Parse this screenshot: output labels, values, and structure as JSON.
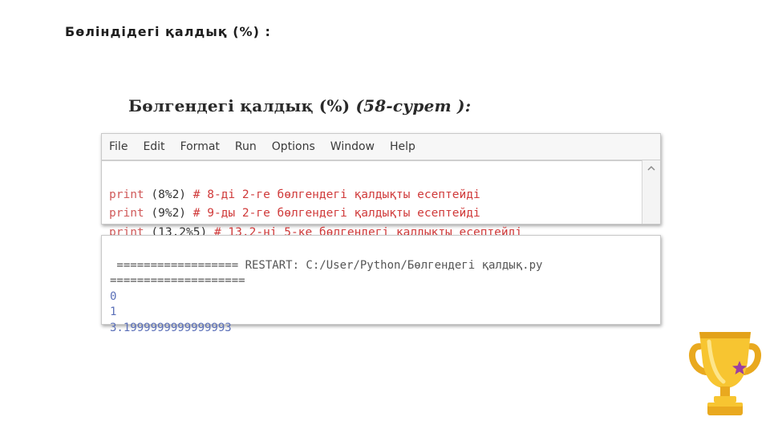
{
  "slide": {
    "title": "Бөліндідегі қалдық (%) :",
    "book_title_main": "Бөлгендегі қалдық (%) ",
    "book_title_ref": "(58-сурет ):"
  },
  "editor": {
    "menu": [
      "File",
      "Edit",
      "Format",
      "Run",
      "Options",
      "Window",
      "Help"
    ],
    "lines": [
      {
        "kw": "print",
        "args": " (8%2) ",
        "comment": "# 8-ді 2-ге бөлгендегі қалдықты есептейді"
      },
      {
        "kw": "print",
        "args": " (9%2) ",
        "comment": "# 9-ды 2-ге бөлгендегі қалдықты есептейді"
      },
      {
        "kw": "print",
        "args": " (13.2%5) ",
        "comment": "# 13.2-ні 5-ке бөлгендегі қалдықты есептейді"
      }
    ]
  },
  "shell": {
    "restart_line1": " ================== RESTART: C:/User/Python/Бөлгендегі қалдық.py",
    "restart_line2": "====================",
    "outputs": [
      "0",
      "1",
      "3.1999999999999993"
    ]
  },
  "colors": {
    "keyword": "#d05a5a",
    "comment": "#d03a3a",
    "output": "#5a6fb8"
  },
  "decoration": {
    "icon": "trophy-icon"
  }
}
